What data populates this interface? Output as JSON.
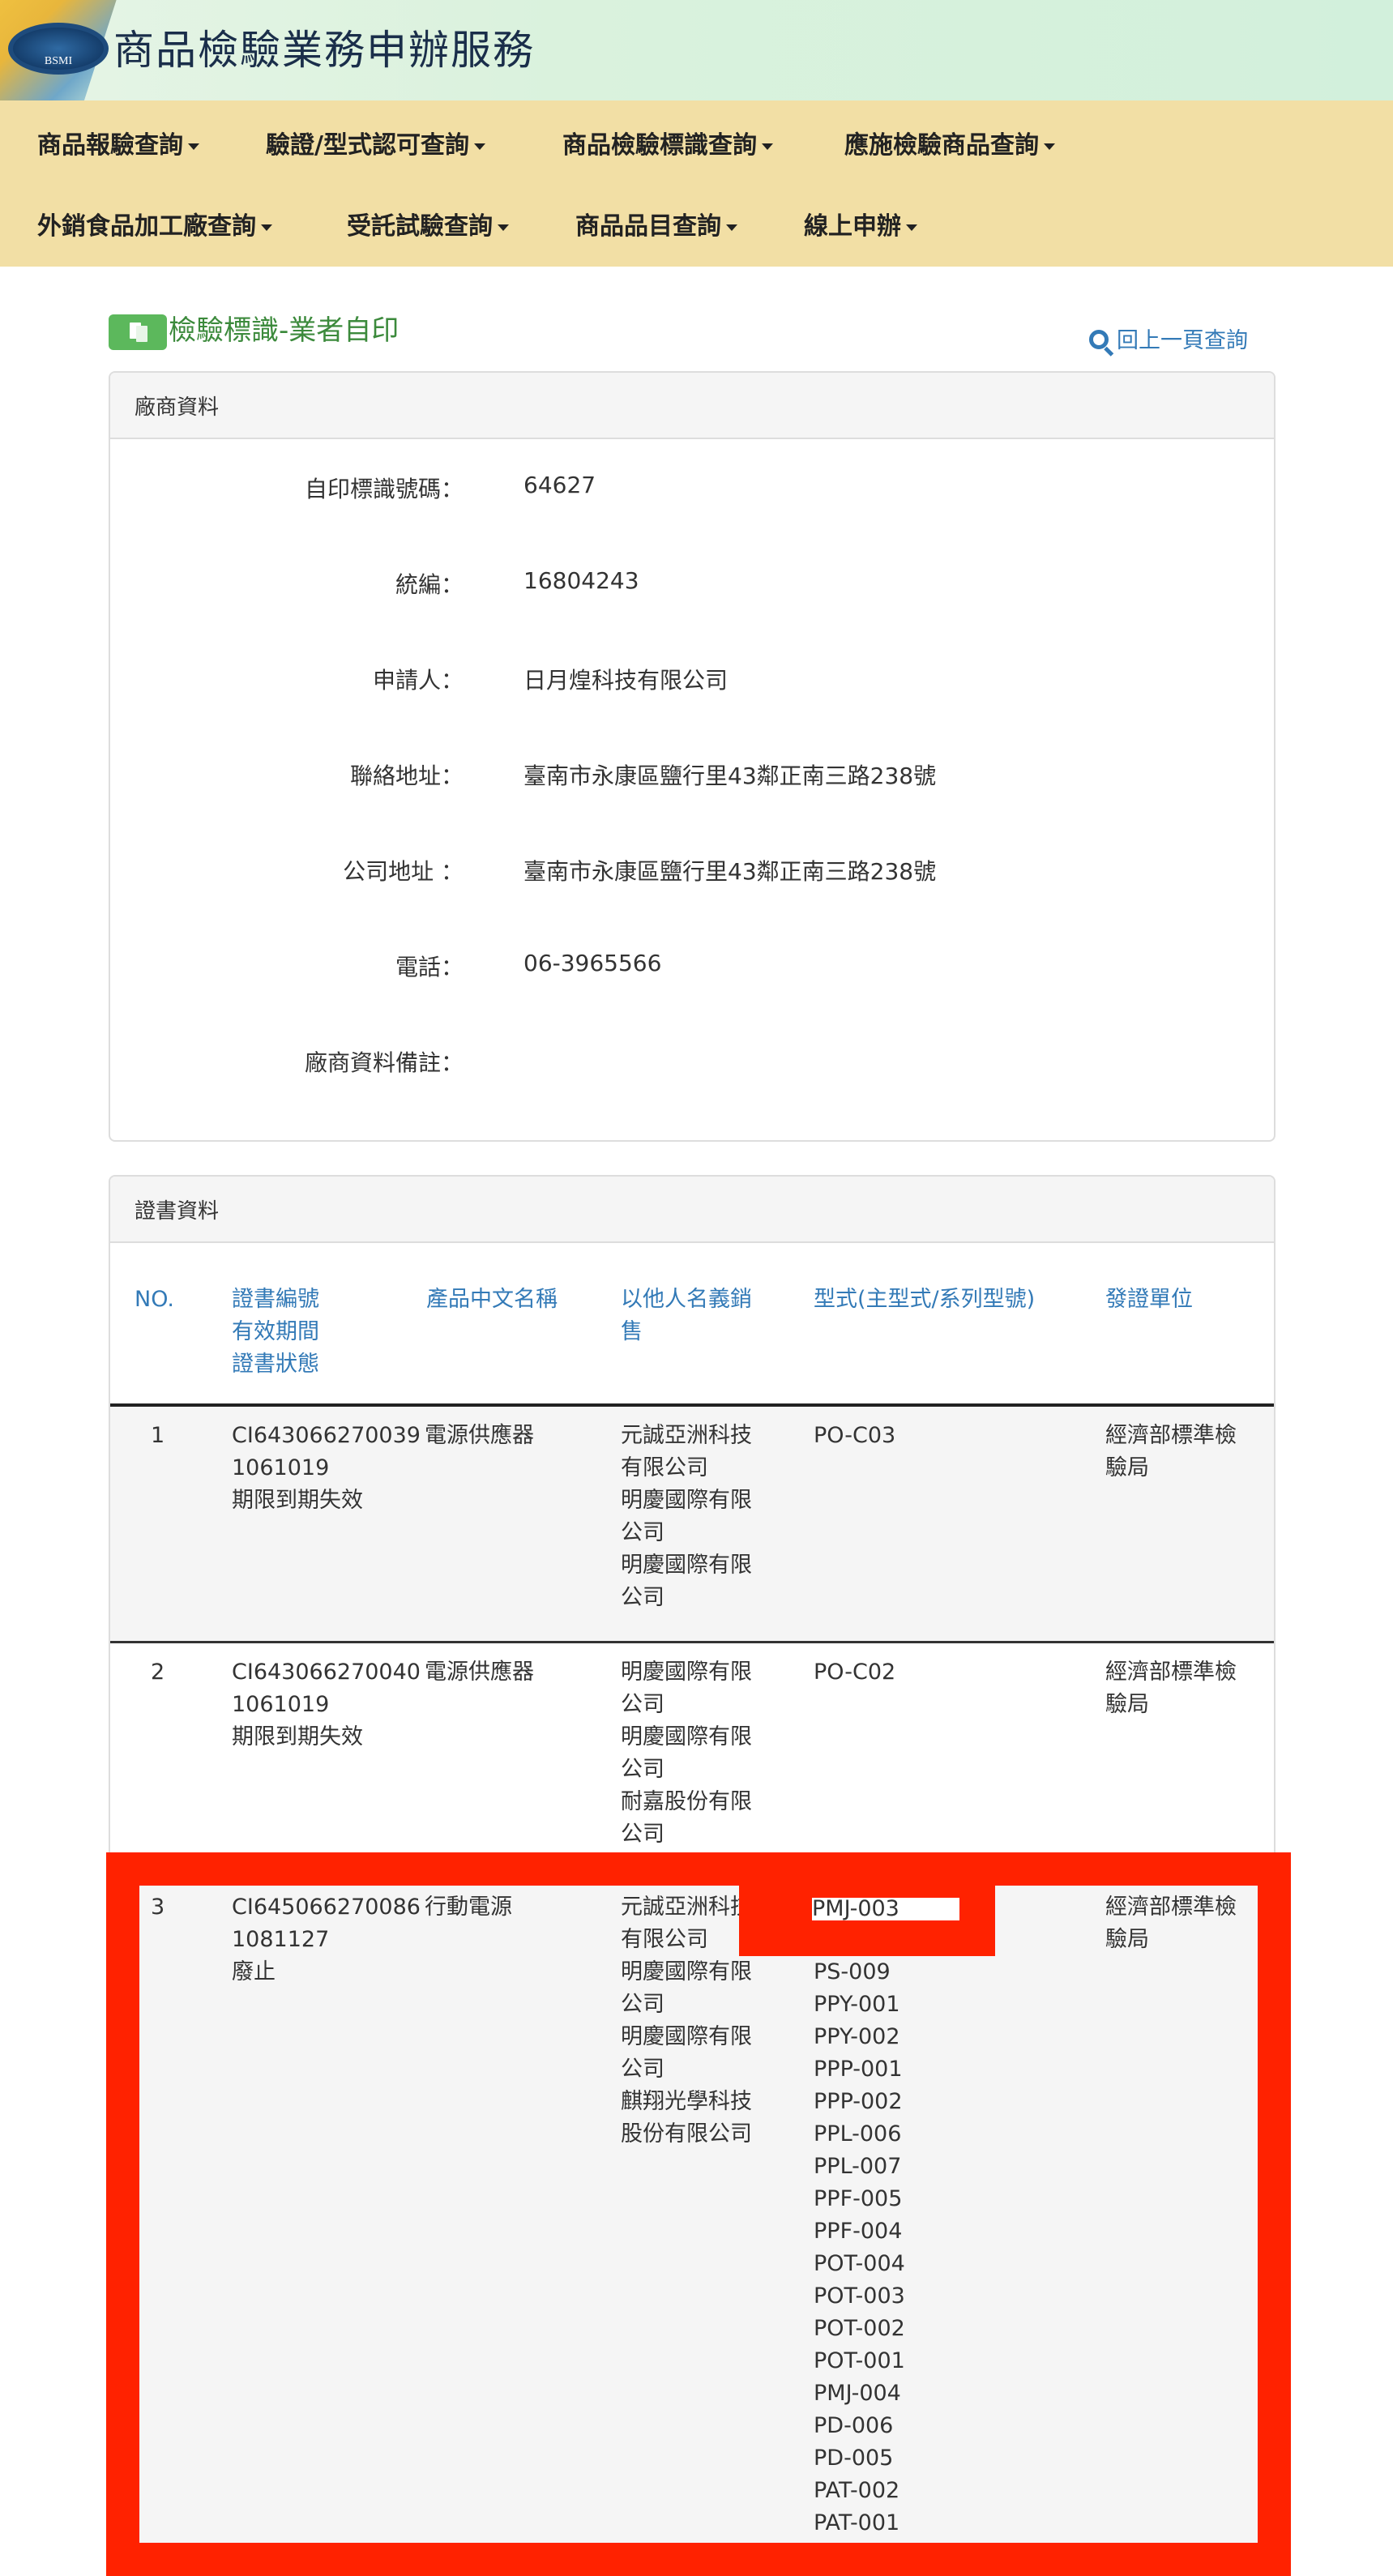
{
  "header": {
    "logo_text": "BSMI",
    "site_title": "商品檢驗業務申辦服務"
  },
  "nav": {
    "items": [
      {
        "label": "商品報驗查詢"
      },
      {
        "label": "驗證/型式認可查詢"
      },
      {
        "label": "商品檢驗標識查詢"
      },
      {
        "label": "應施檢驗商品查詢"
      },
      {
        "label": "外銷食品加工廠查詢"
      },
      {
        "label": "受託試驗查詢"
      },
      {
        "label": "商品品目查詢"
      },
      {
        "label": "線上申辦"
      }
    ]
  },
  "page": {
    "heading": "檢驗標識-業者自印",
    "back_link": "回上一頁查詢"
  },
  "vendor": {
    "panel_title": "廠商資料",
    "fields": [
      {
        "label": "自印標識號碼：",
        "value": "64627"
      },
      {
        "label": "統編：",
        "value": "16804243"
      },
      {
        "label": "申請人：",
        "value": "日月煌科技有限公司"
      },
      {
        "label": "聯絡地址：",
        "value": "臺南市永康區鹽行里43鄰正南三路238號"
      },
      {
        "label": "公司地址 ：",
        "value": "臺南市永康區鹽行里43鄰正南三路238號"
      },
      {
        "label": "電話：",
        "value": "06-3965566"
      },
      {
        "label": "廠商資料備註：",
        "value": ""
      }
    ]
  },
  "certificates": {
    "panel_title": "證書資料",
    "headers": {
      "no": "NO.",
      "cert": [
        "證書編號",
        "有效期間",
        "證書狀態"
      ],
      "product": "產品中文名稱",
      "sold_as": [
        "以他人名義銷",
        "售"
      ],
      "model": "型式(主型式/系列型號)",
      "issuer": "發證單位"
    },
    "rows": [
      {
        "no": "1",
        "cert_no": "CI643066270039",
        "validity": "1061019",
        "status": "期限到期失效",
        "product": "電源供應器",
        "sold_as": [
          "元誠亞洲科技",
          "有限公司",
          "明慶國際有限",
          "公司",
          "明慶國際有限",
          "公司"
        ],
        "models": [
          "PO-C03"
        ],
        "issuer": [
          "經濟部標準檢",
          "驗局"
        ]
      },
      {
        "no": "2",
        "cert_no": "CI643066270040",
        "validity": "1061019",
        "status": "期限到期失效",
        "product": "電源供應器",
        "sold_as": [
          "明慶國際有限",
          "公司",
          "明慶國際有限",
          "公司",
          "耐嘉股份有限",
          "公司"
        ],
        "models": [
          "PO-C02"
        ],
        "issuer": [
          "經濟部標準檢",
          "驗局"
        ]
      },
      {
        "no": "3",
        "cert_no": "CI645066270086",
        "validity": "1081127",
        "status": "廢止",
        "product": "行動電源",
        "sold_as": [
          "元誠亞洲科技",
          "有限公司",
          "明慶國際有限",
          "公司",
          "明慶國際有限",
          "公司",
          "麒翔光學科技",
          "股份有限公司"
        ],
        "models": [
          "PMJ-003",
          "",
          "PS-009",
          "PPY-001",
          "PPY-002",
          "PPP-001",
          "PPP-002",
          "PPL-006",
          "PPL-007",
          "PPF-005",
          "PPF-004",
          "POT-004",
          "POT-003",
          "POT-002",
          "POT-001",
          "PMJ-004",
          "PD-006",
          "PD-005",
          "PAT-002",
          "PAT-001"
        ],
        "issuer": [
          "經濟部標準檢",
          "驗局"
        ]
      }
    ]
  },
  "colors": {
    "header_bg": "#d2f0dc",
    "nav_bg": "#f2dfa5",
    "heading_green": "#3c8a3c",
    "link_blue": "#337ab7",
    "annotation_red": "#ff2200"
  }
}
